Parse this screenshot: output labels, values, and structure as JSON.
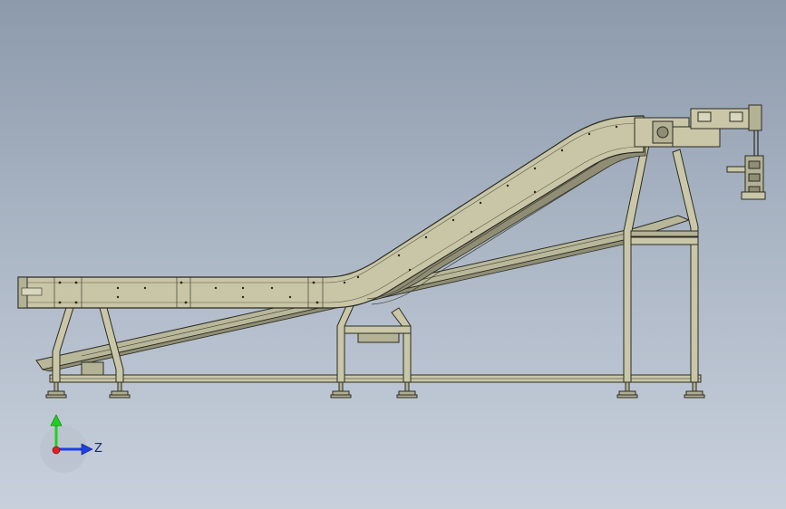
{
  "scene": {
    "description_free": true,
    "colors": {
      "background_top": "#8c9aab",
      "background_bottom": "#c8d0dc",
      "frame_fill": "#c9c7a8",
      "frame_edge": "#2b2b22",
      "conveyor_fill": "#c5c3a2",
      "conveyor_shadow": "#9e9c80",
      "axis_y": "#1fd11f",
      "axis_z": "#1f3fe0",
      "axis_origin": "#e01f1f"
    }
  },
  "triad": {
    "z_label": "Z",
    "icons": [
      "y-axis-arrow-icon",
      "z-axis-arrow-icon",
      "origin-dot-icon"
    ]
  }
}
